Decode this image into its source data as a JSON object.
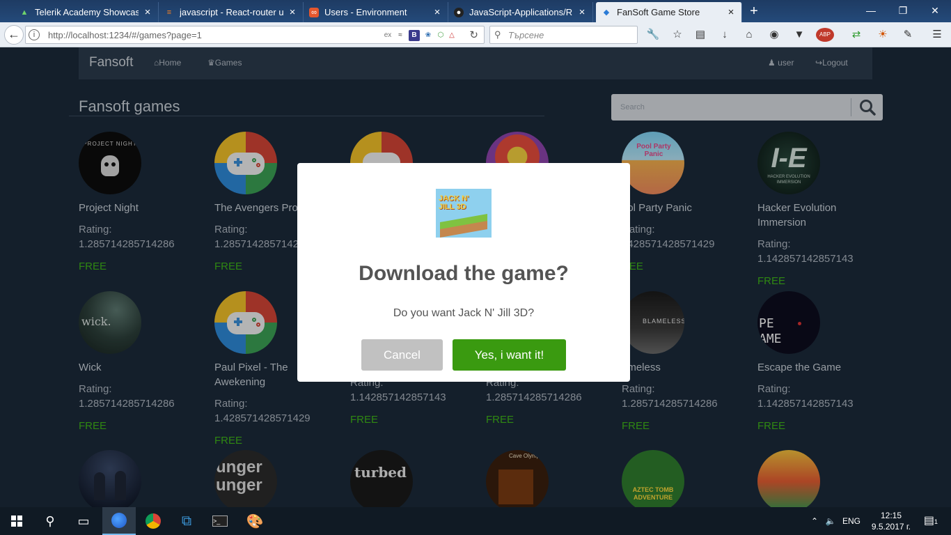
{
  "browser": {
    "tabs": [
      {
        "label": "Telerik Academy Showcase S",
        "icon": "telerik-icon",
        "active": false
      },
      {
        "label": "javascript - React-router urls",
        "icon": "stackoverflow-icon",
        "active": false
      },
      {
        "label": "Users - Environment",
        "icon": "environment-icon",
        "active": false
      },
      {
        "label": "JavaScript-Applications/REA",
        "icon": "github-icon",
        "active": false
      },
      {
        "label": "FanSoft Game Store",
        "icon": "fansoft-icon",
        "active": true
      }
    ],
    "url": "http://localhost:1234/#/games?page=1",
    "search_placeholder": "Търсене",
    "ext_ex": "ex",
    "ext_b": "B",
    "ext_abp": "ABP"
  },
  "site": {
    "brand": "Fansoft",
    "nav": {
      "home": "Home",
      "games": "Games",
      "user": "user",
      "logout": "Logout"
    },
    "section_title": "Fansoft games",
    "search_placeholder": "Search"
  },
  "games": [
    {
      "name": "Project Night",
      "rating_label": "Rating:",
      "rating": "1.285714285714286",
      "price": "FREE"
    },
    {
      "name": "The Avengers Proj",
      "rating_label": "Rating:",
      "rating": "1.2857142857142",
      "price": "FREE"
    },
    {
      "name": "",
      "rating_label": "",
      "rating": "",
      "price": ""
    },
    {
      "name": "",
      "rating_label": "",
      "rating": "",
      "price": ""
    },
    {
      "name": "ool Party Panic",
      "rating_label": "Rating:",
      "rating": "1428571428571429",
      "price": "REE"
    },
    {
      "name": "Hacker Evolution Immersion",
      "rating_label": "Rating:",
      "rating": "1.142857142857143",
      "price": "FREE"
    },
    {
      "name": "Wick",
      "rating_label": "Rating:",
      "rating": "1.285714285714286",
      "price": "FREE"
    },
    {
      "name": "Paul Pixel - The Awekening",
      "rating_label": "Rating:",
      "rating": "1.428571428571429",
      "price": "FREE"
    },
    {
      "name": "",
      "rating_label": "Rating:",
      "rating": "1.142857142857143",
      "price": "FREE"
    },
    {
      "name": "",
      "rating_label": "Rating:",
      "rating": "1.285714285714286",
      "price": "FREE"
    },
    {
      "name": "ameless",
      "rating_label": "Rating:",
      "rating": "1.285714285714286",
      "price": "FREE"
    },
    {
      "name": "Escape the Game",
      "rating_label": "Rating:",
      "rating": "1.142857142857143",
      "price": "FREE"
    }
  ],
  "thumb_texts": {
    "project_night": "PROJECT NIGHT",
    "pool_party": "Pool Party Panic",
    "hacker": "I-E",
    "hacker_sub": "HACKER EVOLUTION IMMERSION",
    "wick": "wick.",
    "blameless": "BLAMELESS",
    "escape": "PE AME",
    "hunger": "unger unger",
    "turbed": "turbed",
    "cave": "Cave Olymp",
    "aztec": "AZTEC TOMB ADVENTURE",
    "jack": "JACK N' JILL 3D"
  },
  "modal": {
    "title": "Download the game?",
    "text": "Do you want Jack N' Jill 3D?",
    "cancel": "Cancel",
    "confirm": "Yes, i want it!"
  },
  "taskbar": {
    "lang": "ENG",
    "time": "12:15",
    "date": "9.5.2017 г.",
    "notif_count": "1"
  },
  "colors": {
    "page_bg": "#1b2a3a",
    "free_green": "#3fb618",
    "confirm_green": "#3a9a10",
    "cancel_gray": "#c1c1c1"
  }
}
